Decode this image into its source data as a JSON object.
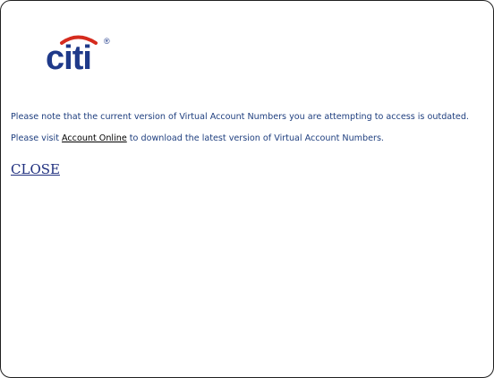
{
  "logo": {
    "name": "citi-logo",
    "text": "citi",
    "registered_mark": "®",
    "colors": {
      "text": "#1f3a8a",
      "arc": "#d52b1e"
    }
  },
  "message": {
    "line1": "Please note that the current version of Virtual Account Numbers you are attempting to access is outdated.",
    "line2_before": "Please visit ",
    "line2_link": "Account Online",
    "line2_after": " to download the latest version of Virtual Account Numbers."
  },
  "close_label": "CLOSE",
  "colors": {
    "message_text": "#1f3f7f",
    "link": "#000000",
    "close_link": "#1f2f7f"
  }
}
